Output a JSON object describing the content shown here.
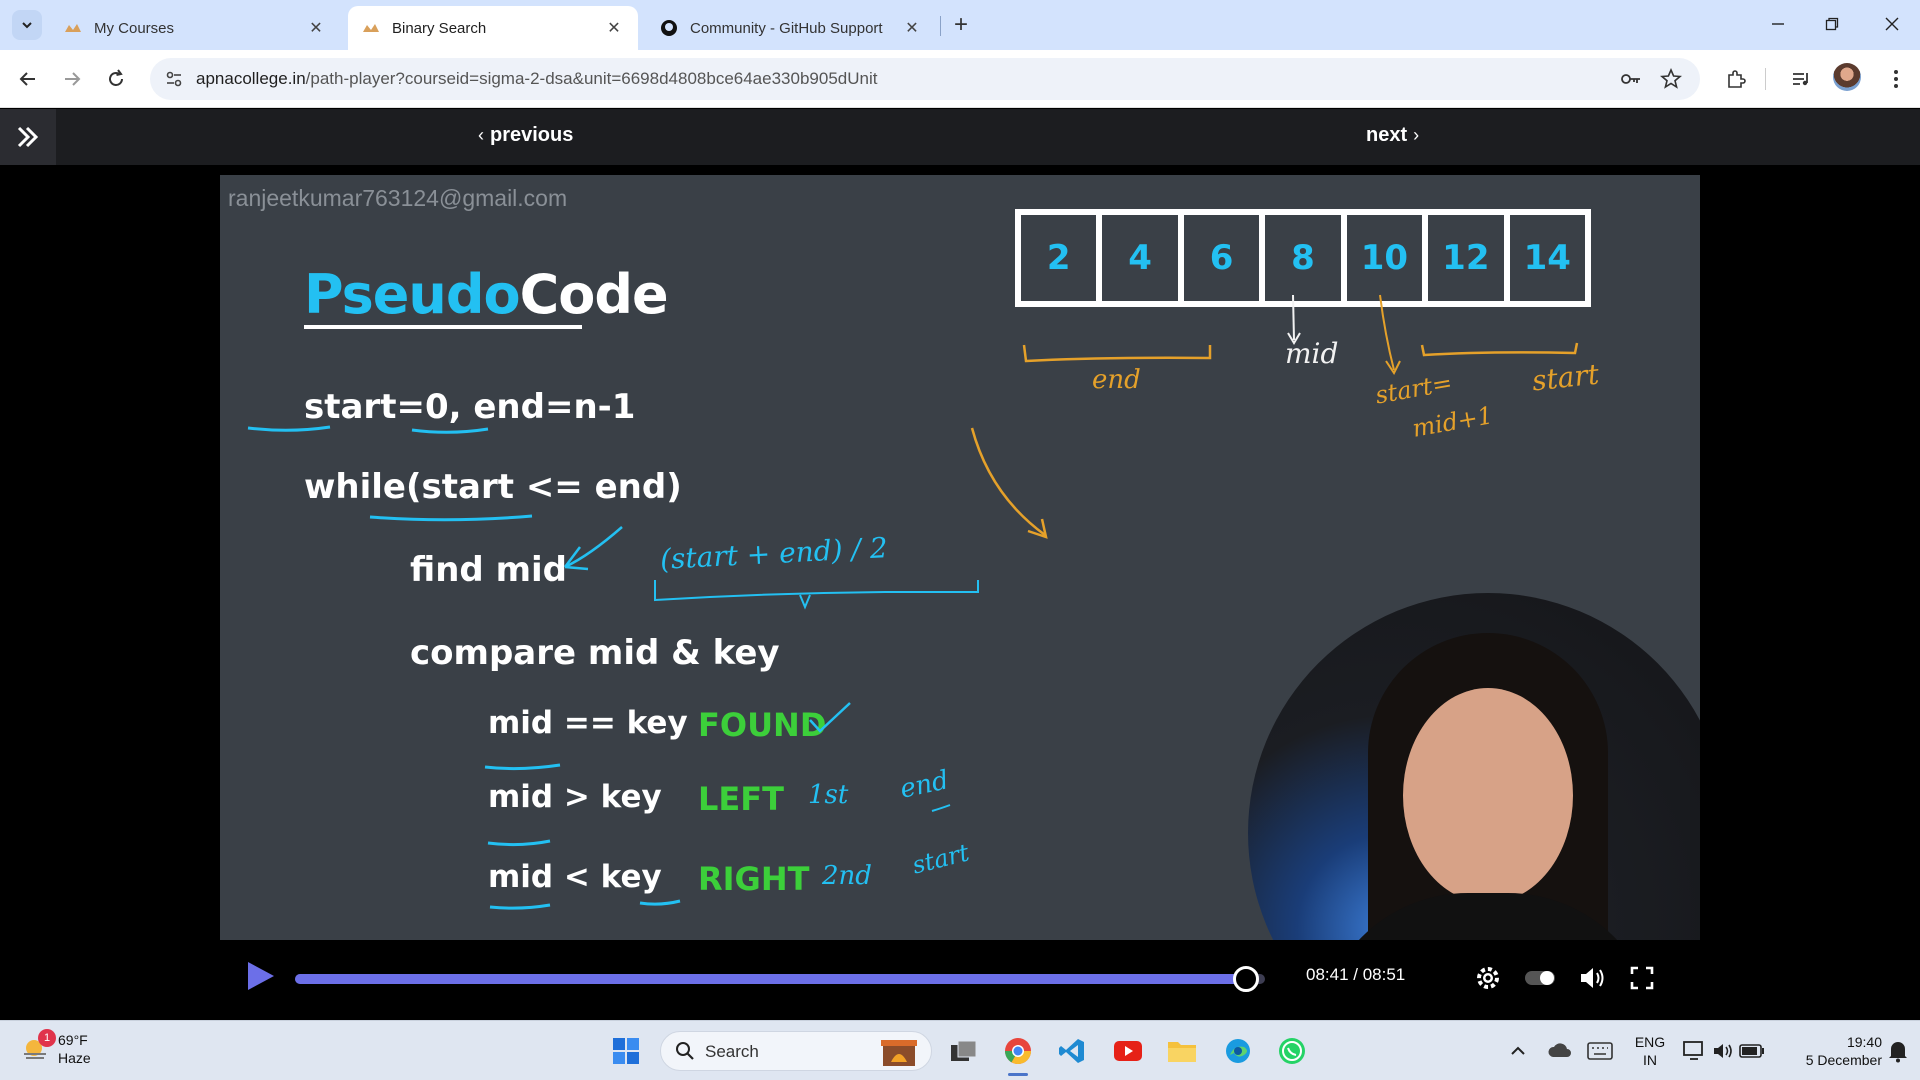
{
  "browser": {
    "tabs": [
      {
        "title": "My Courses",
        "active": false
      },
      {
        "title": "Binary Search",
        "active": true
      },
      {
        "title": "Community - GitHub Support",
        "active": false
      }
    ],
    "url_host": "apnacollege.in",
    "url_path": "/path-player?courseid=sigma-2-dsa&unit=6698d4808bce64ae330b905dUnit"
  },
  "course_nav": {
    "previous_label": "previous",
    "next_label": "next"
  },
  "slide": {
    "watermark": "ranjeetkumar763124@gmail.com",
    "title_part1": "Pseudo",
    "title_part2": "Code",
    "lines": {
      "init": "start=0, end=n-1",
      "loop": "while(start <= end)",
      "find_mid": "find mid",
      "compare": "compare mid & key",
      "case1": "mid == key",
      "case2": "mid > key",
      "case3": "mid < key",
      "result1": "FOUND",
      "result2": "LEFT",
      "result3": "RIGHT"
    },
    "array": [
      "2",
      "4",
      "6",
      "8",
      "10",
      "12",
      "14"
    ],
    "annotations": {
      "end_label": "end",
      "mid_label": "mid",
      "start_eq": "start=",
      "mid_plus_one": "mid+1",
      "start_label": "start",
      "formula": "(start + end) / 2",
      "first": "1st",
      "end_small": "end",
      "second": "2nd",
      "start_small": "start"
    }
  },
  "player": {
    "time": "08:41 / 08:51",
    "progress": 0.98
  },
  "taskbar": {
    "weather_temp": "69°F",
    "weather_desc": "Haze",
    "weather_badge": "1",
    "search_label": "Search",
    "lang_top": "ENG",
    "lang_bottom": "IN",
    "time": "19:40",
    "date": "5 December"
  },
  "colors": {
    "accent_blue": "#23c0f2",
    "accent_green": "#3ccf3a",
    "annotation_orange": "#e5a12a",
    "progress": "#6c6fe8"
  }
}
